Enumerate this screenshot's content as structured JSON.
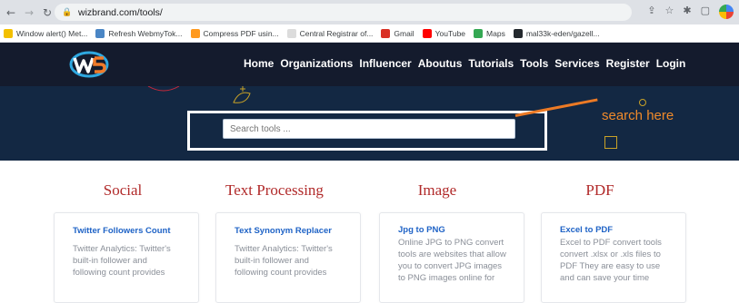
{
  "browser": {
    "url": "wizbrand.com/tools/",
    "bookmarks": [
      {
        "label": "Window alert() Met...",
        "color": "#f3c000"
      },
      {
        "label": "Refresh WebmyTok...",
        "color": "#4a86c5"
      },
      {
        "label": "Compress PDF usin...",
        "color": "#ff9a1f"
      },
      {
        "label": "Central Registrar of...",
        "color": "#dcdcdc"
      },
      {
        "label": "Gmail",
        "color": "#d93025"
      },
      {
        "label": "YouTube",
        "color": "#ff0000"
      },
      {
        "label": "Maps",
        "color": "#34a853"
      },
      {
        "label": "mal33k-eden/gazell...",
        "color": "#24292e"
      }
    ]
  },
  "header": {
    "nav": [
      "Home",
      "Organizations",
      "Influencer",
      "Aboutus",
      "Tutorials",
      "Tools",
      "Services",
      "Register",
      "Login"
    ]
  },
  "hero": {
    "search_placeholder": "Search tools ...",
    "annotation": "search here"
  },
  "categories": [
    {
      "title": "Social",
      "card_title": "Twitter Followers Count",
      "card_text": "Twitter Analytics: Twitter's built-in follower and following count provides"
    },
    {
      "title": "Text Processing",
      "card_title": "Text Synonym Replacer",
      "card_text": "Twitter Analytics: Twitter's built-in follower and following count provides"
    },
    {
      "title": "Image",
      "card_title": "Jpg to PNG",
      "card_text": "Online JPG to PNG convert tools are websites that allow you to convert JPG images to PNG images online for"
    },
    {
      "title": "PDF",
      "card_title": "Excel to PDF",
      "card_text": "Excel to PDF convert tools convert .xlsx or .xls files to PDF They are easy to use and can save your time"
    }
  ],
  "colors": {
    "header_bg": "#141b2d",
    "hero_bg": "#132843",
    "accent_orange": "#ec7a25",
    "category_red": "#b12a2a",
    "link_blue": "#1f63c6"
  }
}
